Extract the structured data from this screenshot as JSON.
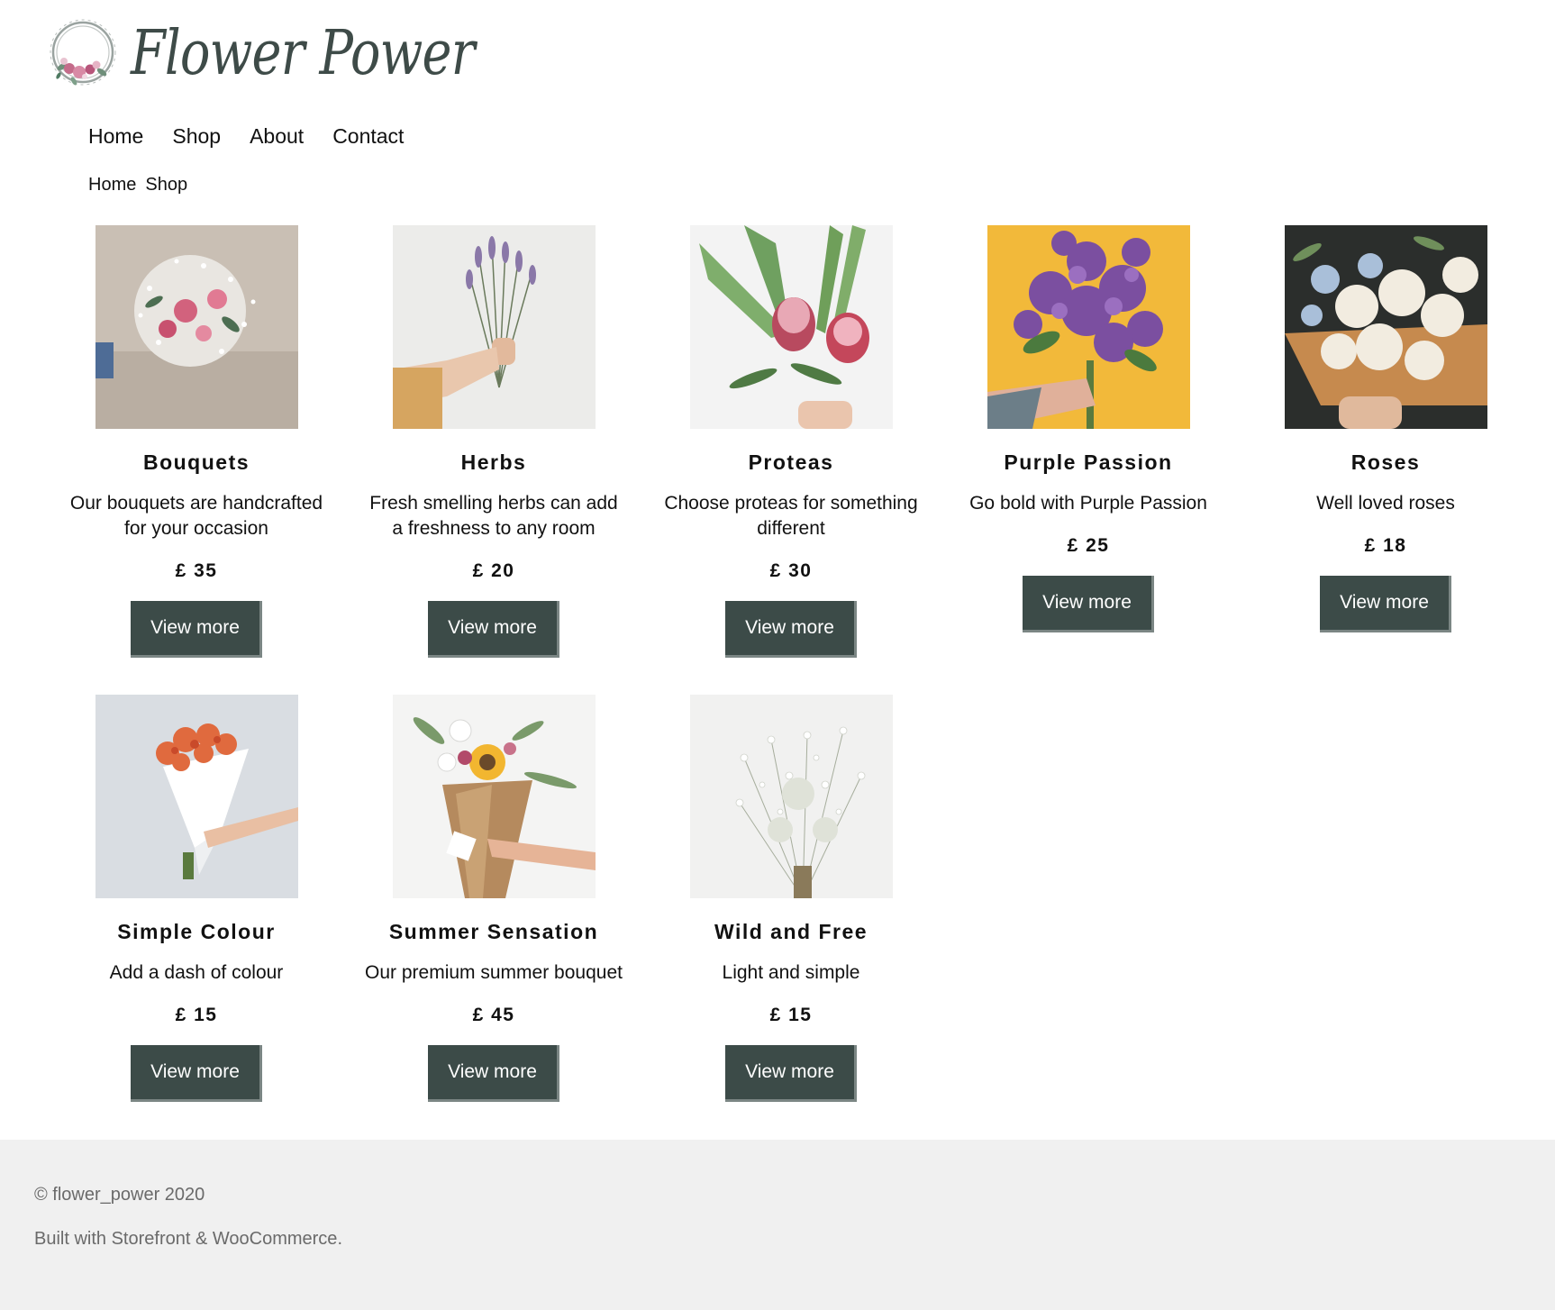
{
  "header": {
    "logo_text": "Flower Power"
  },
  "nav": {
    "items": [
      {
        "label": "Home"
      },
      {
        "label": "Shop"
      },
      {
        "label": "About"
      },
      {
        "label": "Contact"
      }
    ]
  },
  "breadcrumb": {
    "items": [
      {
        "label": "Home"
      },
      {
        "label": "Shop"
      }
    ]
  },
  "products": [
    {
      "title": "Bouquets",
      "desc": "Our bouquets are handcrafted for your occasion",
      "price": "£ 35",
      "button": "View more",
      "image_icon": "pink-rose-bouquet-image"
    },
    {
      "title": "Herbs",
      "desc": "Fresh smelling herbs can add a freshness to any room",
      "price": "£ 20",
      "button": "View more",
      "image_icon": "lavender-bunch-image"
    },
    {
      "title": "Proteas",
      "desc": "Choose proteas for something different",
      "price": "£ 30",
      "button": "View more",
      "image_icon": "protea-bouquet-image"
    },
    {
      "title": "Purple Passion",
      "desc": "Go bold with Purple Passion",
      "price": "£ 25",
      "button": "View more",
      "image_icon": "purple-lilac-image"
    },
    {
      "title": "Roses",
      "desc": "Well loved roses",
      "price": "£ 18",
      "button": "View more",
      "image_icon": "white-roses-image"
    },
    {
      "title": "Simple Colour",
      "desc": "Add a dash of colour",
      "price": "£ 15",
      "button": "View more",
      "image_icon": "orange-flowers-image"
    },
    {
      "title": "Summer Sensation",
      "desc": "Our premium summer bouquet",
      "price": "£ 45",
      "button": "View more",
      "image_icon": "sunflower-bouquet-image"
    },
    {
      "title": "Wild and Free",
      "desc": "Light and simple",
      "price": "£ 15",
      "button": "View more",
      "image_icon": "wildflowers-image"
    }
  ],
  "footer": {
    "copyright": "© flower_power 2020",
    "built_prefix": "Built with ",
    "storefront_link": "Storefront",
    "amp": " & ",
    "woocommerce_link": "WooCommerce",
    "built_suffix": "."
  },
  "colors": {
    "accent": "#3c4b48",
    "footer_bg": "#f0f0f0",
    "footer_text": "#6a6a6a"
  }
}
